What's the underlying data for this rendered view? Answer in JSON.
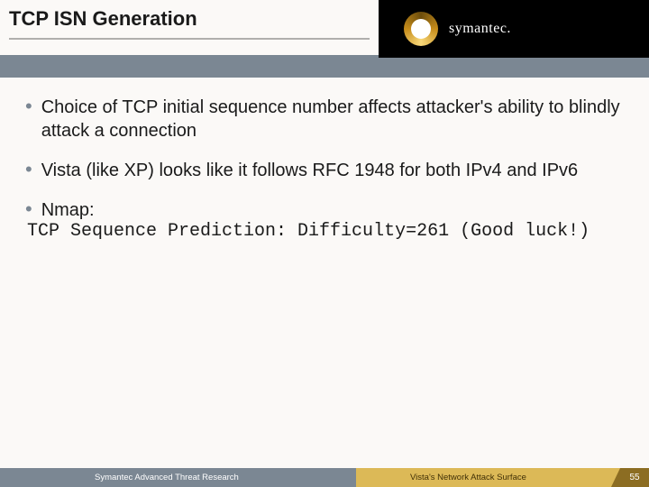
{
  "header": {
    "title": "TCP ISN Generation",
    "brand": "symantec."
  },
  "bullets": [
    "Choice of TCP initial sequence number affects attacker's ability to blindly attack a connection",
    "Vista (like XP) looks like it follows RFC 1948 for both IPv4 and IPv6",
    "Nmap:"
  ],
  "mono_output": "TCP Sequence Prediction: Difficulty=261 (Good luck!)",
  "footer": {
    "left": "Symantec Advanced Threat Research",
    "mid": "Vista's Network Attack Surface",
    "page": "55"
  }
}
